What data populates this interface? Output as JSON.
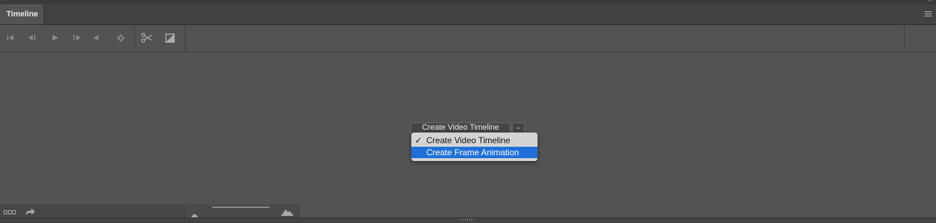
{
  "window": {
    "close_glyph": "×",
    "collapse_glyph": "«"
  },
  "panel": {
    "tab_label": "Timeline",
    "menu_icon": "hamburger-menu-icon"
  },
  "toolbar": {
    "buttons": [
      {
        "name": "go-to-first-frame",
        "icon": "skip-to-start-icon"
      },
      {
        "name": "previous-frame",
        "icon": "step-back-icon"
      },
      {
        "name": "play",
        "icon": "play-icon"
      },
      {
        "name": "next-frame",
        "icon": "step-forward-icon"
      },
      {
        "name": "audio",
        "icon": "speaker-icon"
      },
      {
        "name": "settings",
        "icon": "gear-icon"
      },
      {
        "name": "split-at-playhead",
        "icon": "scissors-icon"
      },
      {
        "name": "transition",
        "icon": "transition-icon"
      }
    ]
  },
  "create": {
    "button_label": "Create Video Timeline",
    "dropdown_glyph": "⌄",
    "menu": [
      {
        "label": "Create Video Timeline",
        "checked": true,
        "check_glyph": "✓"
      },
      {
        "label": "Create Frame Animation",
        "checked": false,
        "check_glyph": ""
      }
    ]
  },
  "bottombar": {
    "icons": [
      "convert-to-frame-animation-icon",
      "render-video-icon",
      "zoom-out-mountain-icon",
      "zoom-in-mountain-icon"
    ],
    "zoom": {
      "label": "zoom slider"
    }
  },
  "colors": {
    "panel_bg": "#535353",
    "menu_bg": "#d4d4d4",
    "menu_highlight": "#1f6fd9"
  }
}
